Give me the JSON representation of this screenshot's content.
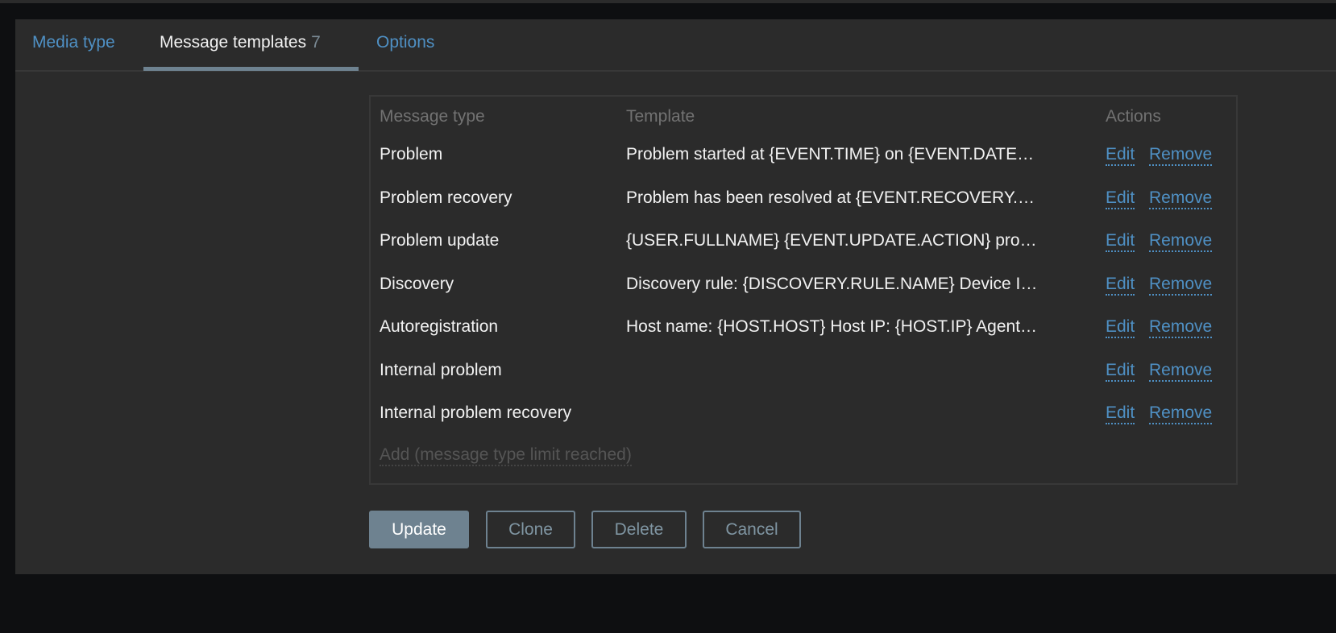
{
  "tabs": [
    {
      "label": "Media type"
    },
    {
      "label": "Message templates",
      "count": "7"
    },
    {
      "label": "Options"
    }
  ],
  "table": {
    "headers": {
      "message_type": "Message type",
      "template": "Template",
      "actions": "Actions"
    },
    "rows": [
      {
        "type": "Problem",
        "template": "Problem started at {EVENT.TIME} on {EVENT.DATE…",
        "edit": "Edit",
        "remove": "Remove"
      },
      {
        "type": "Problem recovery",
        "template": "Problem has been resolved at {EVENT.RECOVERY.…",
        "edit": "Edit",
        "remove": "Remove"
      },
      {
        "type": "Problem update",
        "template": "{USER.FULLNAME} {EVENT.UPDATE.ACTION} pro…",
        "edit": "Edit",
        "remove": "Remove"
      },
      {
        "type": "Discovery",
        "template": "Discovery rule: {DISCOVERY.RULE.NAME} Device I…",
        "edit": "Edit",
        "remove": "Remove"
      },
      {
        "type": "Autoregistration",
        "template": "Host name: {HOST.HOST} Host IP: {HOST.IP} Agent…",
        "edit": "Edit",
        "remove": "Remove"
      },
      {
        "type": "Internal problem",
        "template": "",
        "edit": "Edit",
        "remove": "Remove"
      },
      {
        "type": "Internal problem recovery",
        "template": "",
        "edit": "Edit",
        "remove": "Remove"
      }
    ],
    "add_label": "Add (message type limit reached)"
  },
  "buttons": {
    "update": "Update",
    "clone": "Clone",
    "delete": "Delete",
    "cancel": "Cancel"
  }
}
